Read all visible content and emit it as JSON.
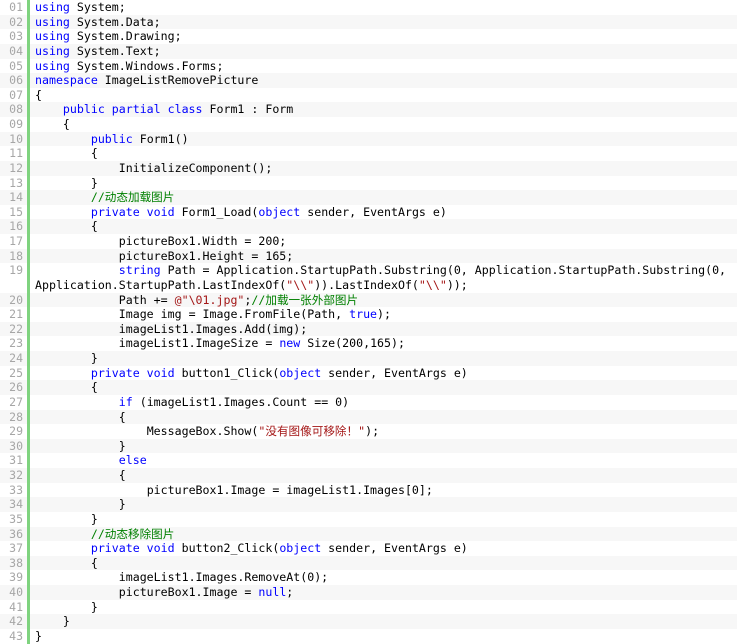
{
  "editor": {
    "language": "csharp",
    "colors": {
      "keyword": "#0000ff",
      "string": "#a31515",
      "comment": "#008000",
      "text": "#000000",
      "line_number": "#a6a6a6",
      "gutter_bar": "#7fd37f",
      "background": "#ffffff",
      "alt_row_background": "#f7f7f7"
    },
    "first_line_number": 1,
    "last_line_number": 43,
    "total_lines": 43
  },
  "lines": [
    {
      "num": "01",
      "tokens": [
        {
          "t": "using",
          "c": "kw"
        },
        {
          "t": " System;",
          "c": "plain"
        }
      ]
    },
    {
      "num": "02",
      "tokens": [
        {
          "t": "using",
          "c": "kw"
        },
        {
          "t": " System.Data;",
          "c": "plain"
        }
      ]
    },
    {
      "num": "03",
      "tokens": [
        {
          "t": "using",
          "c": "kw"
        },
        {
          "t": " System.Drawing;",
          "c": "plain"
        }
      ]
    },
    {
      "num": "04",
      "tokens": [
        {
          "t": "using",
          "c": "kw"
        },
        {
          "t": " System.Text;",
          "c": "plain"
        }
      ]
    },
    {
      "num": "05",
      "tokens": [
        {
          "t": "using",
          "c": "kw"
        },
        {
          "t": " System.Windows.Forms;",
          "c": "plain"
        }
      ]
    },
    {
      "num": "06",
      "tokens": [
        {
          "t": "namespace",
          "c": "kw"
        },
        {
          "t": " ImageListRemovePicture",
          "c": "plain"
        }
      ]
    },
    {
      "num": "07",
      "tokens": [
        {
          "t": "{",
          "c": "plain"
        }
      ]
    },
    {
      "num": "08",
      "tokens": [
        {
          "t": "    ",
          "c": "plain"
        },
        {
          "t": "public partial class",
          "c": "kw"
        },
        {
          "t": " Form1 : Form",
          "c": "plain"
        }
      ]
    },
    {
      "num": "09",
      "tokens": [
        {
          "t": "    {",
          "c": "plain"
        }
      ]
    },
    {
      "num": "10",
      "tokens": [
        {
          "t": "        ",
          "c": "plain"
        },
        {
          "t": "public",
          "c": "kw"
        },
        {
          "t": " Form1()",
          "c": "plain"
        }
      ]
    },
    {
      "num": "11",
      "tokens": [
        {
          "t": "        {",
          "c": "plain"
        }
      ]
    },
    {
      "num": "12",
      "tokens": [
        {
          "t": "            InitializeComponent();",
          "c": "plain"
        }
      ]
    },
    {
      "num": "13",
      "tokens": [
        {
          "t": "        }",
          "c": "plain"
        }
      ]
    },
    {
      "num": "14",
      "tokens": [
        {
          "t": "        ",
          "c": "plain"
        },
        {
          "t": "//动态加载图片",
          "c": "cmt"
        }
      ]
    },
    {
      "num": "15",
      "tokens": [
        {
          "t": "        ",
          "c": "plain"
        },
        {
          "t": "private void",
          "c": "kw"
        },
        {
          "t": " Form1_Load(",
          "c": "plain"
        },
        {
          "t": "object",
          "c": "kw"
        },
        {
          "t": " sender, EventArgs e)",
          "c": "plain"
        }
      ]
    },
    {
      "num": "16",
      "tokens": [
        {
          "t": "        {",
          "c": "plain"
        }
      ]
    },
    {
      "num": "17",
      "tokens": [
        {
          "t": "            pictureBox1.Width = 200;",
          "c": "plain"
        }
      ]
    },
    {
      "num": "18",
      "tokens": [
        {
          "t": "            pictureBox1.Height = 165;",
          "c": "plain"
        }
      ]
    },
    {
      "num": "19",
      "tokens": [
        {
          "t": "            ",
          "c": "plain"
        },
        {
          "t": "string",
          "c": "kw"
        },
        {
          "t": " Path = Application.StartupPath.Substring(0, Application.StartupPath.Substring(0, Application.StartupPath.LastIndexOf(",
          "c": "plain"
        },
        {
          "t": "\"\\\\\"",
          "c": "str"
        },
        {
          "t": ")).LastIndexOf(",
          "c": "plain"
        },
        {
          "t": "\"\\\\\"",
          "c": "str"
        },
        {
          "t": "));",
          "c": "plain"
        }
      ]
    },
    {
      "num": "20",
      "tokens": [
        {
          "t": "            Path += ",
          "c": "plain"
        },
        {
          "t": "@\"\\01.jpg\"",
          "c": "str"
        },
        {
          "t": ";",
          "c": "plain"
        },
        {
          "t": "//加载一张外部图片",
          "c": "cmt"
        }
      ]
    },
    {
      "num": "21",
      "tokens": [
        {
          "t": "            Image img = Image.FromFile(Path, ",
          "c": "plain"
        },
        {
          "t": "true",
          "c": "kw"
        },
        {
          "t": ");",
          "c": "plain"
        }
      ]
    },
    {
      "num": "22",
      "tokens": [
        {
          "t": "            imageList1.Images.Add(img);",
          "c": "plain"
        }
      ]
    },
    {
      "num": "23",
      "tokens": [
        {
          "t": "            imageList1.ImageSize = ",
          "c": "plain"
        },
        {
          "t": "new",
          "c": "kw"
        },
        {
          "t": " Size(200,165);",
          "c": "plain"
        }
      ]
    },
    {
      "num": "24",
      "tokens": [
        {
          "t": "        }",
          "c": "plain"
        }
      ]
    },
    {
      "num": "25",
      "tokens": [
        {
          "t": "        ",
          "c": "plain"
        },
        {
          "t": "private void",
          "c": "kw"
        },
        {
          "t": " button1_Click(",
          "c": "plain"
        },
        {
          "t": "object",
          "c": "kw"
        },
        {
          "t": " sender, EventArgs e)",
          "c": "plain"
        }
      ]
    },
    {
      "num": "26",
      "tokens": [
        {
          "t": "        {",
          "c": "plain"
        }
      ]
    },
    {
      "num": "27",
      "tokens": [
        {
          "t": "            ",
          "c": "plain"
        },
        {
          "t": "if",
          "c": "kw"
        },
        {
          "t": " (imageList1.Images.Count == 0)",
          "c": "plain"
        }
      ]
    },
    {
      "num": "28",
      "tokens": [
        {
          "t": "            {",
          "c": "plain"
        }
      ]
    },
    {
      "num": "29",
      "tokens": [
        {
          "t": "                MessageBox.Show(",
          "c": "plain"
        },
        {
          "t": "\"没有图像可移除！\"",
          "c": "str"
        },
        {
          "t": ");",
          "c": "plain"
        }
      ]
    },
    {
      "num": "30",
      "tokens": [
        {
          "t": "            }",
          "c": "plain"
        }
      ]
    },
    {
      "num": "31",
      "tokens": [
        {
          "t": "            ",
          "c": "plain"
        },
        {
          "t": "else",
          "c": "kw"
        }
      ]
    },
    {
      "num": "32",
      "tokens": [
        {
          "t": "            {",
          "c": "plain"
        }
      ]
    },
    {
      "num": "33",
      "tokens": [
        {
          "t": "                pictureBox1.Image = imageList1.Images[0];",
          "c": "plain"
        }
      ]
    },
    {
      "num": "34",
      "tokens": [
        {
          "t": "            }",
          "c": "plain"
        }
      ]
    },
    {
      "num": "35",
      "tokens": [
        {
          "t": "        }",
          "c": "plain"
        }
      ]
    },
    {
      "num": "36",
      "tokens": [
        {
          "t": "        ",
          "c": "plain"
        },
        {
          "t": "//动态移除图片",
          "c": "cmt"
        }
      ]
    },
    {
      "num": "37",
      "tokens": [
        {
          "t": "        ",
          "c": "plain"
        },
        {
          "t": "private void",
          "c": "kw"
        },
        {
          "t": " button2_Click(",
          "c": "plain"
        },
        {
          "t": "object",
          "c": "kw"
        },
        {
          "t": " sender, EventArgs e)",
          "c": "plain"
        }
      ]
    },
    {
      "num": "38",
      "tokens": [
        {
          "t": "        {",
          "c": "plain"
        }
      ]
    },
    {
      "num": "39",
      "tokens": [
        {
          "t": "            imageList1.Images.RemoveAt(0);",
          "c": "plain"
        }
      ]
    },
    {
      "num": "40",
      "tokens": [
        {
          "t": "            pictureBox1.Image = ",
          "c": "plain"
        },
        {
          "t": "null",
          "c": "kw"
        },
        {
          "t": ";",
          "c": "plain"
        }
      ]
    },
    {
      "num": "41",
      "tokens": [
        {
          "t": "        }",
          "c": "plain"
        }
      ]
    },
    {
      "num": "42",
      "tokens": [
        {
          "t": "    }",
          "c": "plain"
        }
      ]
    },
    {
      "num": "43",
      "tokens": [
        {
          "t": "}",
          "c": "plain"
        }
      ]
    }
  ]
}
